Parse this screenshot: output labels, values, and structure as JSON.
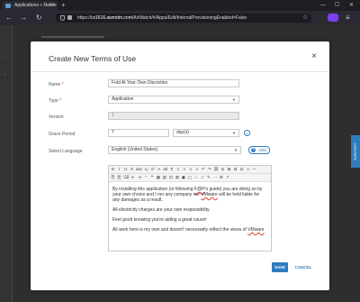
{
  "browser": {
    "tab_title": "Applications » Native",
    "new_tab": "+",
    "url_prefix": "https://",
    "url_domain": "cx1616.awmdm.com",
    "url_path": "/AirWatch/#/Apps/Edit/InternalProvisioningEnabled=False",
    "minimize": "—",
    "maximize": "☐",
    "close": "✕",
    "back": "←",
    "forward": "→",
    "reload": "↻",
    "star": "☆",
    "menu": "≡"
  },
  "support_tab": "SUPPORT",
  "modal": {
    "title": "Create New Terms of Use",
    "close": "×",
    "fields": {
      "name_label": "Name",
      "name_value": "Fold At Your Own Discretion",
      "type_label": "Type",
      "type_value": "Application",
      "version_label": "Version",
      "version_value": "1",
      "grace_label": "Grace Period",
      "grace_value": "7",
      "grace_unit": "day(s)",
      "language_label": "Select Language",
      "language_value": "English (United States)",
      "required_mark": "*",
      "info": "i",
      "add_label": "ADD",
      "add_plus": "+"
    },
    "editor": {
      "toolbar_row1": [
        "B",
        "I",
        "U",
        "S",
        "abc",
        "x₂",
        "x²",
        "A",
        "ab",
        "¶",
        "≡",
        "≡",
        "≡",
        "≡",
        "↶",
        "↷",
        "⛓",
        "⊘",
        "⊞",
        "⊟",
        "Ω",
        "☺",
        "—"
      ],
      "toolbar_row2": [
        "⎘",
        "⎗",
        "⌫",
        "⇤",
        "⇥",
        "“",
        "❝",
        "▦",
        "▤",
        "⊡",
        "⊠",
        "▣",
        "▢",
        "⌂",
        "⌕",
        "✎",
        "⋯",
        "⚙",
        "?"
      ],
      "paragraphs": [
        {
          "parts": [
            "By installing this application (or following ",
            "F@H",
            "'s guide) you are doing so by your own choice and I nor any company nor ",
            "VMware",
            " will be held liable for any damages as a result."
          ]
        },
        {
          "parts": [
            "All electricity charges are your own responsibility."
          ]
        },
        {
          "parts": [
            "Feel good knowing you're aiding a great cause!"
          ]
        },
        {
          "parts": [
            "All work here is my own and doesn't necessarily reflect the views of ",
            "VMware",
            ""
          ]
        }
      ]
    },
    "save_label": "SAVE",
    "cancel_label": "CANCEL"
  }
}
